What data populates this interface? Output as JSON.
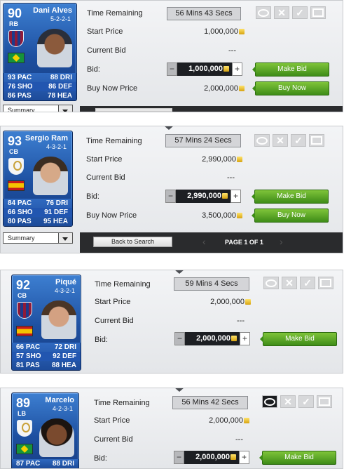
{
  "labels": {
    "time_remaining": "Time Remaining",
    "start_price": "Start Price",
    "current_bid": "Current Bid",
    "bid": "Bid:",
    "buy_now_price": "Buy Now Price"
  },
  "buttons": {
    "make_bid": "Make Bid",
    "buy_now": "Buy Now",
    "back_to_search": "Back to Search"
  },
  "summary_select": {
    "value": "Summary"
  },
  "pager": {
    "text": "PAGE 1 OF 1"
  },
  "currency_icon": "coin-icon",
  "colors": {
    "card_blue": "#1d4fa0",
    "make_bid_green": "#4f9f24",
    "bid_field": "#1d1f23"
  },
  "listings": [
    {
      "rating": "90",
      "position": "RB",
      "name": "Dani Alves",
      "formation": "5-2-2-1",
      "club": "FC Barcelona crest",
      "nation": "Brazil flag",
      "stats": [
        [
          "93 PAC",
          "88 DRI"
        ],
        [
          "76 SHO",
          "86 DEF"
        ],
        [
          "86 PAS",
          "78 HEA"
        ]
      ],
      "time_remaining": "56 Mins 43 Secs",
      "start_price": "1,000,000",
      "current_bid": "---",
      "bid": "1,000,000",
      "buy_now": "2,000,000",
      "watched": false
    },
    {
      "rating": "93",
      "position": "CB",
      "name": "Sergio Ram",
      "formation": "4-3-2-1",
      "club": "Real Madrid crest",
      "nation": "Spain flag",
      "stats": [
        [
          "84 PAC",
          "76 DRI"
        ],
        [
          "66 SHO",
          "91 DEF"
        ],
        [
          "80 PAS",
          "95 HEA"
        ]
      ],
      "time_remaining": "57 Mins 24 Secs",
      "start_price": "2,990,000",
      "current_bid": "---",
      "bid": "2,990,000",
      "buy_now": "3,500,000",
      "watched": false
    },
    {
      "rating": "92",
      "position": "CB",
      "name": "Piqué",
      "formation": "4-3-2-1",
      "club": "FC Barcelona crest",
      "nation": "Spain flag",
      "stats": [
        [
          "66 PAC",
          "72 DRI"
        ],
        [
          "57 SHO",
          "92 DEF"
        ],
        [
          "81 PAS",
          "88 HEA"
        ]
      ],
      "time_remaining": "59 Mins 4 Secs",
      "start_price": "2,000,000",
      "current_bid": "---",
      "bid": "2,000,000",
      "watched": false
    },
    {
      "rating": "89",
      "position": "LB",
      "name": "Marcelo",
      "formation": "4-2-3-1",
      "club": "Real Madrid crest",
      "nation": "Brazil flag",
      "stats": [
        [
          "87 PAC",
          "88 DRI"
        ]
      ],
      "time_remaining": "56 Mins 42 Secs",
      "start_price": "2,000,000",
      "current_bid": "---",
      "bid": "2,000,000",
      "watched": true
    }
  ]
}
